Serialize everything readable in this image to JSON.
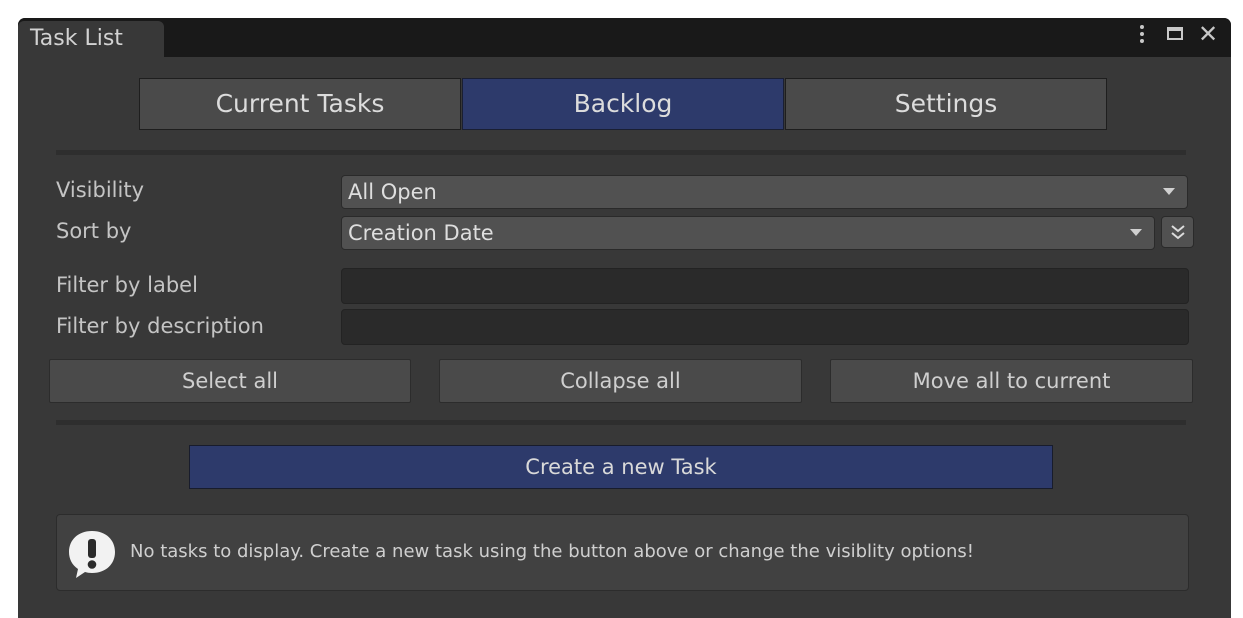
{
  "window": {
    "title": "Task List"
  },
  "tabs": [
    {
      "label": "Current Tasks",
      "active": false
    },
    {
      "label": "Backlog",
      "active": true
    },
    {
      "label": "Settings",
      "active": false
    }
  ],
  "filters": {
    "visibility_label": "Visibility",
    "visibility_value": "All Open",
    "sort_label": "Sort by",
    "sort_value": "Creation Date",
    "label_filter_label": "Filter by label",
    "label_filter_value": "",
    "description_filter_label": "Filter by description",
    "description_filter_value": ""
  },
  "actions": {
    "select_all": "Select all",
    "collapse_all": "Collapse all",
    "move_all": "Move all to current"
  },
  "create_button": "Create a new Task",
  "help_message": "No tasks to display. Create a new task using the button above or change the visiblity options!",
  "icons": {
    "window_menu": "kebab-menu-icon",
    "maximize": "maximize-icon",
    "close": "close-icon",
    "sort_direction": "double-chevron-down-icon",
    "info": "exclamation-bubble-icon"
  },
  "colors": {
    "accent": "#2d3a6b",
    "background": "#383838"
  }
}
